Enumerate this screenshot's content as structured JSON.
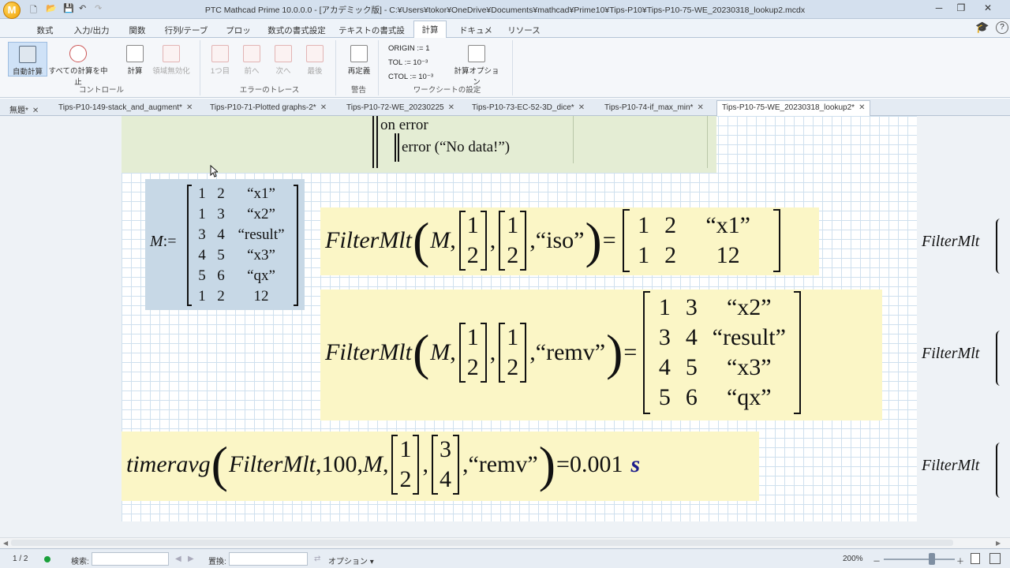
{
  "window": {
    "title": "PTC Mathcad Prime 10.0.0.0 - [アカデミック版] - C:¥Users¥tokor¥OneDrive¥Documents¥mathcad¥Prime10¥Tips-P10¥Tips-P10-75-WE_20230318_lookup2.mcdx",
    "logo": "M"
  },
  "ribbon_tabs": [
    "数式",
    "入力/出力",
    "関数",
    "行列/テーブル",
    "プロット",
    "数式の書式設定",
    "テキストの書式設定",
    "計算",
    "ドキュメント",
    "リソース"
  ],
  "active_tab": "計算",
  "ribbon": {
    "auto_calc": "自動計算",
    "stop_all": "すべての計算を中止",
    "calculate": "計算",
    "disable_region": "領域無効化",
    "control_label": "コントロール",
    "first": "1つ目",
    "prev": "前へ",
    "next": "次へ",
    "last": "最後",
    "error_trace_label": "エラーのトレース",
    "redefine": "再定義",
    "warnings_label": "警告",
    "origin": "ORIGIN :=  1",
    "tol": "TOL :=  10⁻³",
    "ctol": "CTOL :=  10⁻³",
    "calc_options": "計算オプション",
    "worksheet_settings_label": "ワークシートの設定"
  },
  "doc_tabs": [
    "無題*",
    "Tips-P10-149-stack_and_augment*",
    "Tips-P10-71-Plotted graphs-2*",
    "Tips-P10-72-WE_20230225",
    "Tips-P10-73-EC-52-3D_dice*",
    "Tips-P10-74-if_max_min*",
    "Tips-P10-75-WE_20230318_lookup2*"
  ],
  "active_doc_tab": "Tips-P10-75-WE_20230318_lookup2*",
  "worksheet": {
    "program": {
      "on_error": "on error",
      "error_call": "error (“No data!”)"
    },
    "matrix_def": {
      "name": "M",
      "assign": ":=",
      "rows": [
        [
          "1",
          "2",
          "“x1”"
        ],
        [
          "1",
          "3",
          "“x2”"
        ],
        [
          "3",
          "4",
          "“result”"
        ],
        [
          "4",
          "5",
          "“x3”"
        ],
        [
          "5",
          "6",
          "“qx”"
        ],
        [
          "1",
          "2",
          "12"
        ]
      ]
    },
    "eq1": {
      "fn": "FilterMlt",
      "arg_m": "M",
      "v1": [
        "1",
        "2"
      ],
      "v2": [
        "1",
        "2"
      ],
      "mode": "“iso”",
      "equals": "=",
      "result": [
        [
          "1",
          "2",
          "“x1”"
        ],
        [
          "1",
          "2",
          "12"
        ]
      ]
    },
    "eq2": {
      "fn": "FilterMlt",
      "arg_m": "M",
      "v1": [
        "1",
        "2"
      ],
      "v2": [
        "1",
        "2"
      ],
      "mode": "“remv”",
      "equals": "=",
      "result": [
        [
          "1",
          "3",
          "“x2”"
        ],
        [
          "3",
          "4",
          "“result”"
        ],
        [
          "4",
          "5",
          "“x3”"
        ],
        [
          "5",
          "6",
          "“qx”"
        ]
      ]
    },
    "eq3": {
      "fn": "timeravg",
      "inner_fn": "FilterMlt",
      "n": "100",
      "arg_m": "M",
      "v1": [
        "1",
        "2"
      ],
      "v2": [
        "3",
        "4"
      ],
      "mode": "“remv”",
      "equals": "=",
      "value": "0.001",
      "unit": "s"
    },
    "right_cut": "FilterMlt"
  },
  "status": {
    "page": "1 / 2",
    "search_label": "検索:",
    "replace_label": "置換:",
    "options": "オプション",
    "zoom": "200%"
  }
}
